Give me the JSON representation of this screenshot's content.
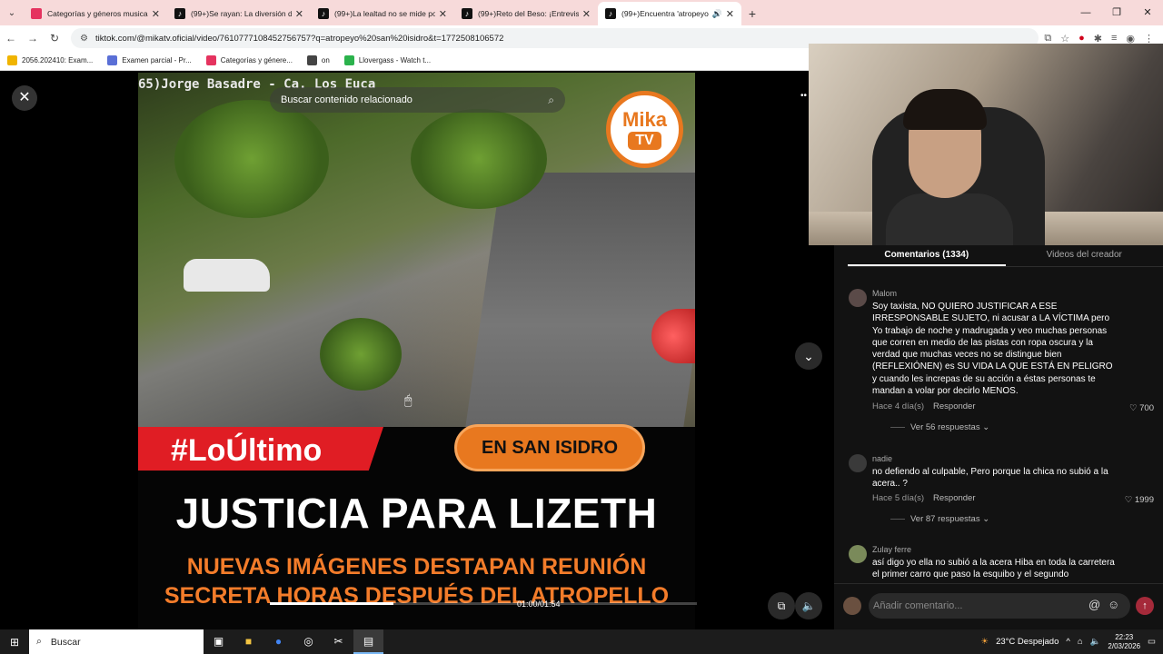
{
  "browser": {
    "tabs": [
      {
        "label": "Categorías y géneros musicales",
        "icon": "music-icon",
        "active": false
      },
      {
        "label": "(99+)Se rayan: La diversión de",
        "icon": "tiktok-icon",
        "active": false
      },
      {
        "label": "(99+)La lealtad no se mide por",
        "icon": "tiktok-icon",
        "active": false
      },
      {
        "label": "(99+)Reto del Beso: ¡Entrevista",
        "icon": "tiktok-icon",
        "active": false
      },
      {
        "label": "(99+)Encuentra 'atropeyo s",
        "icon": "tiktok-icon",
        "active": true
      }
    ],
    "url": "tiktok.com/@mikatv.oficial/video/7610777108452756757?q=atropeyo%20san%20isidro&t=1772508106572",
    "bookmarks": [
      {
        "label": "2056.202410: Exam...",
        "color": "#f0b400"
      },
      {
        "label": "Examen parcial - Pr...",
        "color": "#5a6fd6"
      },
      {
        "label": "Categorías y génere...",
        "color": "#e5335f"
      },
      {
        "label": "on",
        "color": "#444"
      },
      {
        "label": "Llovergass - Watch t...",
        "color": "#2bb24c"
      }
    ]
  },
  "video": {
    "search_placeholder": "Buscar contenido relacionado",
    "osd_text": "65)Jorge Basadre - Ca. Los Euca",
    "logo_top": "Mika",
    "logo_bottom": "TV",
    "tag": "#LoÚltimo",
    "place": "EN SAN ISIDRO",
    "headline": "JUSTICIA PARA LIZETH",
    "subline1": "NUEVAS IMÁGENES DESTAPAN REUNIÓN",
    "subline2": "SECRETA HORAS DESPUÉS DEL ATROPELLO",
    "time": "01:00/01:54",
    "progress_fraction": 0.29
  },
  "comments_panel": {
    "tab_comments": "Comentarios (1334)",
    "tab_videos": "Videos del creador",
    "items": [
      {
        "user": "Malom",
        "text": "Soy taxista, NO QUIERO JUSTIFICAR A ESE IRRESPONSABLE SUJETO, ni acusar a LA VÍCTIMA pero Yo trabajo de noche y madrugada y veo muchas personas que corren en medio de las pistas con ropa oscura y la verdad que muchas veces no se distingue bien (REFLEXIÓNEN) es SU VIDA LA QUE ESTÁ EN PELIGRO y cuando les increpas de su acción a éstas personas te mandan a volar por decirlo MENOS.",
        "time": "Hace 4 día(s)",
        "reply": "Responder",
        "likes": "700",
        "more": "Ver 56 respuestas"
      },
      {
        "user": "nadie",
        "text": "no defiendo al culpable, Pero porque la chica no subió a la acera.. ?",
        "time": "Hace 5 día(s)",
        "reply": "Responder",
        "likes": "1999",
        "more": "Ver 87 respuestas"
      },
      {
        "user": "Zulay ferre",
        "text": "así digo yo ella no subió a la acera Hiba en toda la carretera el primer carro que paso la esquibo y el segundo"
      }
    ],
    "input_placeholder": "Añadir comentario..."
  },
  "taskbar": {
    "search": "Buscar",
    "weather": "23°C Despejado",
    "time": "22:23",
    "date": "2/03/2026"
  }
}
